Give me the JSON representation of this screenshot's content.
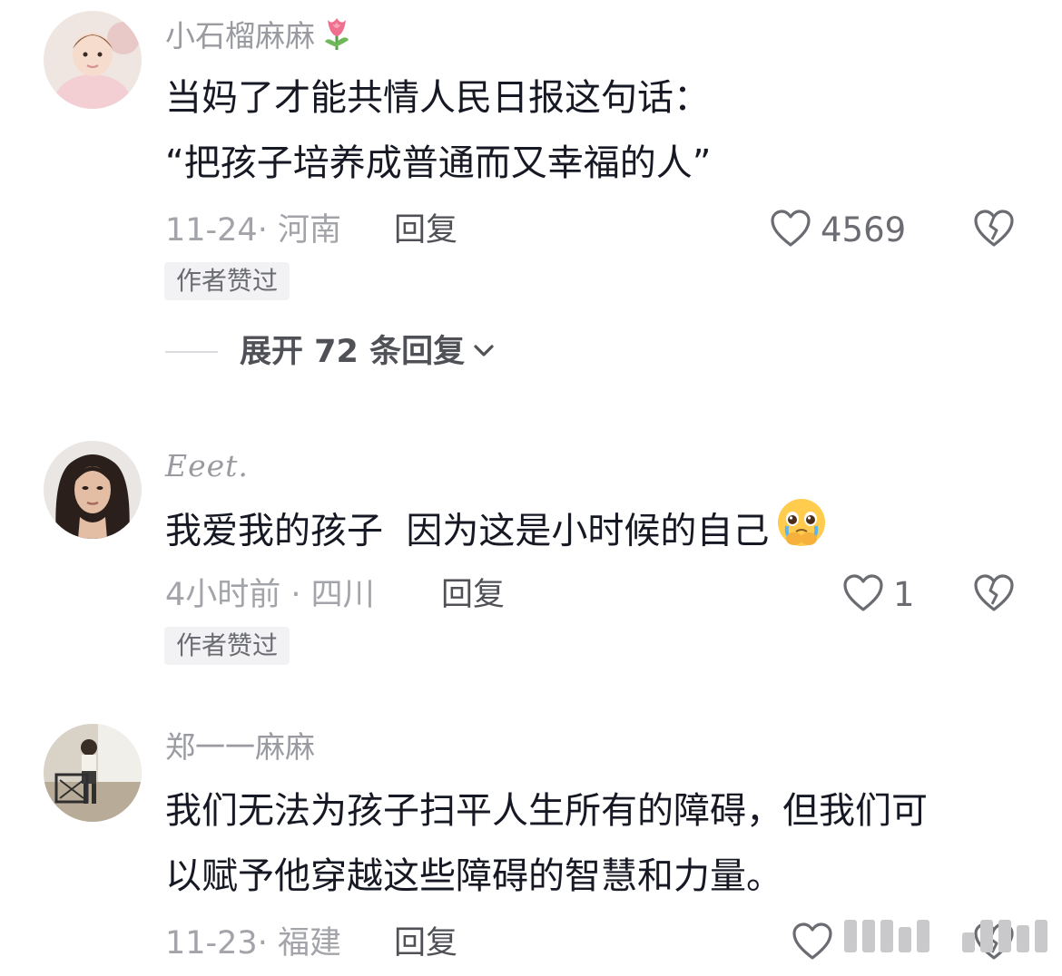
{
  "comments": [
    {
      "username": "小石榴麻麻",
      "username_emoji": "tulip-emoji",
      "lines": [
        "当妈了才能共情人民日报这句话：",
        "“把孩子培养成普通而又幸福的人”"
      ],
      "date_location": "11-24· 河南",
      "reply_label": "回复",
      "like_count": "4569",
      "badge": "作者赞过",
      "expand_label": "展开 72 条回复"
    },
    {
      "username": "Eeet.",
      "lines": [
        "我爱我的孩子  因为这是小时候的自己"
      ],
      "body_emoji": "crying-pleading-emoji",
      "date_location": "4小时前 · 四川",
      "reply_label": "回复",
      "like_count": "1",
      "badge": "作者赞过"
    },
    {
      "username": "郑一一麻麻",
      "lines": [
        "我们无法为孩子扫平人生所有的障碍，但我们可",
        "以赋予他穿越这些障碍的智慧和力量。"
      ],
      "date_location": "11-23· 福建",
      "reply_label": "回复"
    }
  ],
  "icons": {
    "like": "heart-outline-icon",
    "dislike": "broken-heart-icon",
    "expand": "chevron-down-icon"
  },
  "colors": {
    "text_primary": "#161823",
    "text_secondary": "#9a9ba1",
    "badge_bg": "#f2f2f4"
  }
}
